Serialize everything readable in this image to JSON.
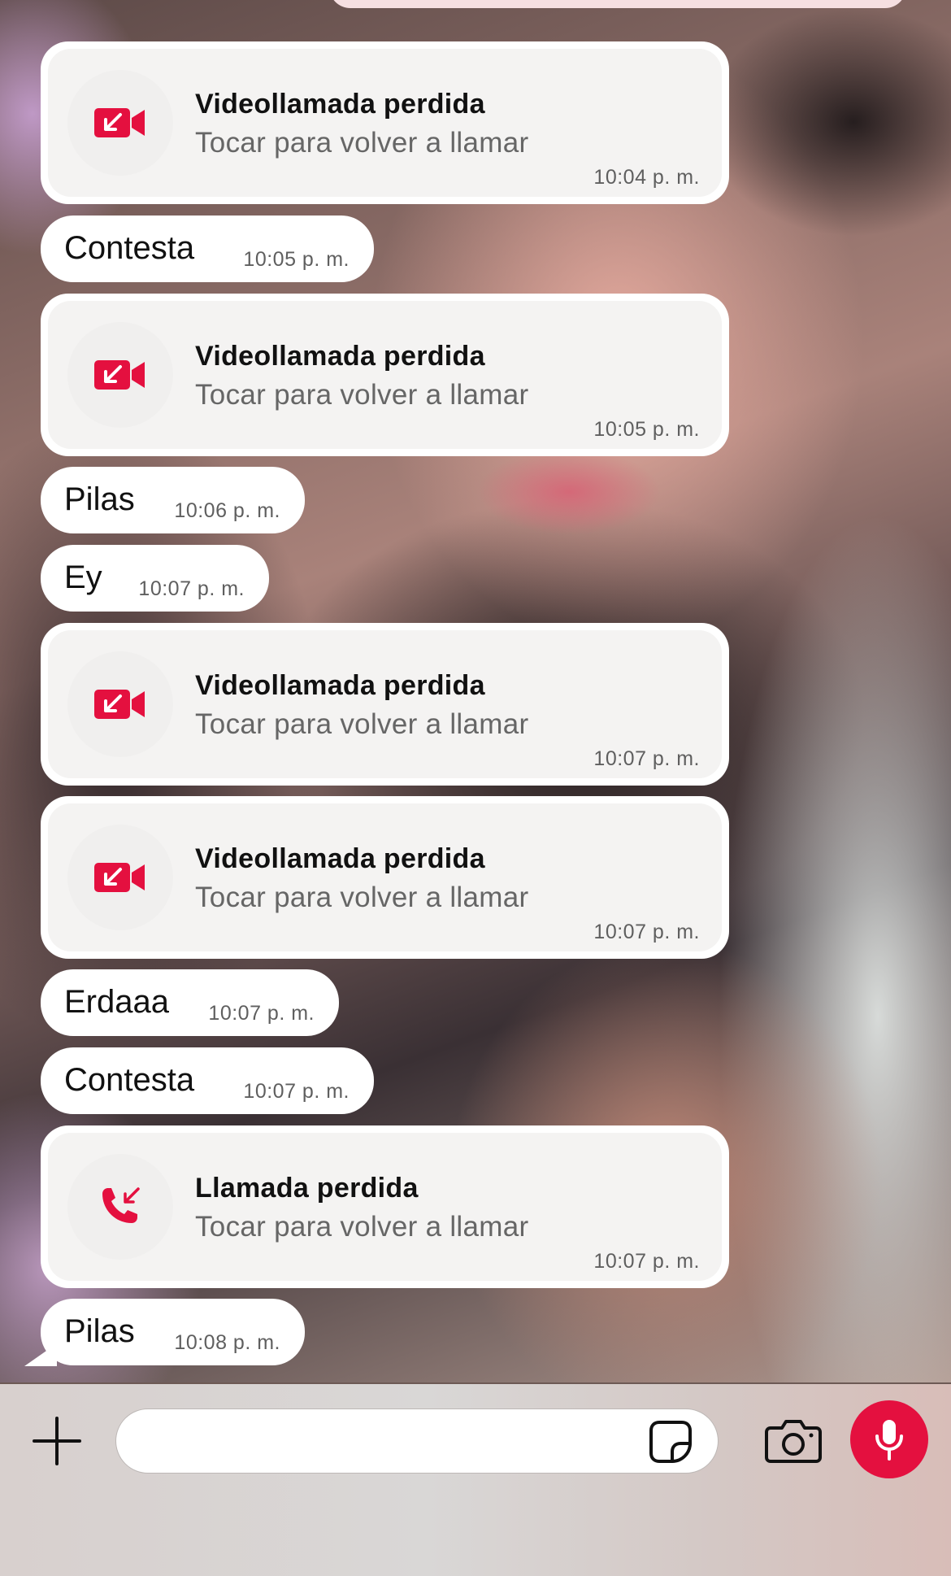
{
  "colors": {
    "accent": "#e4103f",
    "bubble": "#ffffff",
    "call_card": "#f4f3f2"
  },
  "messages": [
    {
      "type": "call",
      "icon": "missed-video-call-icon",
      "title": "Videollamada perdida",
      "subtitle": "Tocar para volver a llamar",
      "time": "10:04 p. m."
    },
    {
      "type": "text",
      "text": "Contesta",
      "time": "10:05 p. m."
    },
    {
      "type": "call",
      "icon": "missed-video-call-icon",
      "title": "Videollamada perdida",
      "subtitle": "Tocar para volver a llamar",
      "time": "10:05 p. m."
    },
    {
      "type": "text",
      "text": "Pilas",
      "time": "10:06 p. m."
    },
    {
      "type": "text",
      "text": "Ey",
      "time": "10:07 p. m."
    },
    {
      "type": "call",
      "icon": "missed-video-call-icon",
      "title": "Videollamada perdida",
      "subtitle": "Tocar para volver a llamar",
      "time": "10:07 p. m."
    },
    {
      "type": "call",
      "icon": "missed-video-call-icon",
      "title": "Videollamada perdida",
      "subtitle": "Tocar para volver a llamar",
      "time": "10:07 p. m."
    },
    {
      "type": "text",
      "text": "Erdaaa",
      "time": "10:07 p. m."
    },
    {
      "type": "text",
      "text": "Contesta",
      "time": "10:07 p. m."
    },
    {
      "type": "call",
      "icon": "missed-voice-call-icon",
      "title": "Llamada perdida",
      "subtitle": "Tocar para volver a llamar",
      "time": "10:07 p. m."
    },
    {
      "type": "text",
      "text": "Pilas",
      "time": "10:08 p. m."
    }
  ],
  "composer": {
    "plus_icon": "plus-icon",
    "input_value": "",
    "input_placeholder": "",
    "sticker_icon": "sticker-icon",
    "camera_icon": "camera-icon",
    "mic_icon": "microphone-icon"
  }
}
